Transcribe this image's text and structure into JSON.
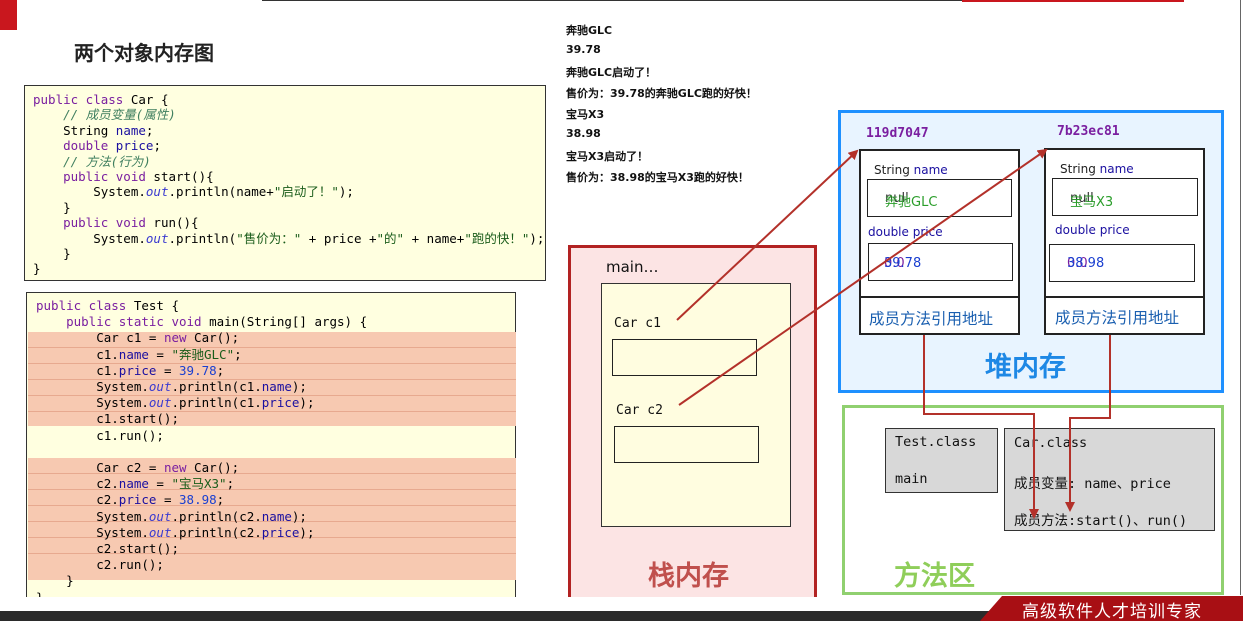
{
  "title": "两个对象内存图",
  "car_class_code": [
    {
      "parts": [
        [
          "kw",
          "public class "
        ],
        [
          "",
          "Car {"
        ]
      ]
    },
    {
      "parts": [
        [
          "cm",
          "    // 成员变量(属性)"
        ]
      ]
    },
    {
      "parts": [
        [
          "",
          "    String "
        ],
        [
          "var",
          "name"
        ],
        [
          "",
          ";"
        ]
      ]
    },
    {
      "parts": [
        [
          "kw",
          "    double "
        ],
        [
          "var",
          "price"
        ],
        [
          "",
          ";"
        ]
      ]
    },
    {
      "parts": [
        [
          "cm",
          "    // 方法(行为)"
        ]
      ]
    },
    {
      "parts": [
        [
          "kw",
          "    public void "
        ],
        [
          "",
          "start(){"
        ]
      ]
    },
    {
      "parts": [
        [
          "",
          "        System."
        ],
        [
          "it",
          "out"
        ],
        [
          "",
          ".println(name+"
        ],
        [
          "str",
          "\"启动了！\""
        ],
        [
          "",
          ");"
        ]
      ]
    },
    {
      "parts": [
        [
          "",
          "    }"
        ]
      ]
    },
    {
      "parts": [
        [
          "kw",
          "    public void "
        ],
        [
          "",
          "run(){"
        ]
      ]
    },
    {
      "parts": [
        [
          "",
          "        System."
        ],
        [
          "it",
          "out"
        ],
        [
          "",
          ".println("
        ],
        [
          "str",
          "\"售价为：\""
        ],
        [
          "",
          " + price +"
        ],
        [
          "str",
          "\"的\""
        ],
        [
          "",
          " + name+"
        ],
        [
          "str",
          "\"跑的快！\""
        ],
        [
          "",
          ");"
        ]
      ]
    },
    {
      "parts": [
        [
          "",
          "    }"
        ]
      ]
    },
    {
      "parts": [
        [
          "",
          "}"
        ]
      ]
    }
  ],
  "test_class_code": [
    {
      "parts": [
        [
          "kw",
          "public class "
        ],
        [
          "",
          "Test {"
        ]
      ]
    },
    {
      "parts": [
        [
          "kw",
          "    public static void "
        ],
        [
          "",
          "main(String[] args) {"
        ]
      ]
    },
    {
      "parts": [
        [
          "",
          "        Car c1 = "
        ],
        [
          "kw",
          "new "
        ],
        [
          "",
          "Car();"
        ]
      ]
    },
    {
      "parts": [
        [
          "",
          "        c1."
        ],
        [
          "var",
          "name"
        ],
        [
          "",
          " = "
        ],
        [
          "str",
          "\"奔驰GLC\""
        ],
        [
          "",
          ";"
        ]
      ]
    },
    {
      "parts": [
        [
          "",
          "        c1."
        ],
        [
          "var",
          "price"
        ],
        [
          "",
          " = "
        ],
        [
          "num",
          "39.78"
        ],
        [
          "",
          ";"
        ]
      ]
    },
    {
      "parts": [
        [
          "",
          "        System."
        ],
        [
          "it",
          "out"
        ],
        [
          "",
          ".println(c1."
        ],
        [
          "var",
          "name"
        ],
        [
          "",
          ");"
        ]
      ]
    },
    {
      "parts": [
        [
          "",
          "        System."
        ],
        [
          "it",
          "out"
        ],
        [
          "",
          ".println(c1."
        ],
        [
          "var",
          "price"
        ],
        [
          "",
          ");"
        ]
      ]
    },
    {
      "parts": [
        [
          "",
          "        c1.start();"
        ]
      ]
    },
    {
      "parts": [
        [
          "",
          "        c1.run();"
        ]
      ]
    },
    {
      "parts": [
        [
          "",
          ""
        ]
      ]
    },
    {
      "parts": [
        [
          "",
          "        Car c2 = "
        ],
        [
          "kw",
          "new "
        ],
        [
          "",
          "Car();"
        ]
      ]
    },
    {
      "parts": [
        [
          "",
          "        c2."
        ],
        [
          "var",
          "name"
        ],
        [
          "",
          " = "
        ],
        [
          "str",
          "\"宝马X3\""
        ],
        [
          "",
          ";"
        ]
      ]
    },
    {
      "parts": [
        [
          "",
          "        c2."
        ],
        [
          "var",
          "price"
        ],
        [
          "",
          " = "
        ],
        [
          "num",
          "38.98"
        ],
        [
          "",
          ";"
        ]
      ]
    },
    {
      "parts": [
        [
          "",
          "        System."
        ],
        [
          "it",
          "out"
        ],
        [
          "",
          ".println(c2."
        ],
        [
          "var",
          "name"
        ],
        [
          "",
          ");"
        ]
      ]
    },
    {
      "parts": [
        [
          "",
          "        System."
        ],
        [
          "it",
          "out"
        ],
        [
          "",
          ".println(c2."
        ],
        [
          "var",
          "price"
        ],
        [
          "",
          ");"
        ]
      ]
    },
    {
      "parts": [
        [
          "",
          "        c2.start();"
        ]
      ]
    },
    {
      "parts": [
        [
          "",
          "        c2.run();"
        ]
      ]
    },
    {
      "parts": [
        [
          "",
          "    }"
        ]
      ]
    },
    {
      "parts": [
        [
          "",
          "}"
        ]
      ]
    }
  ],
  "console_output": [
    "奔驰GLC",
    "39.78",
    "奔驰GLC启动了！",
    "售价为：39.78的奔驰GLC跑的好快！",
    "宝马X3",
    "38.98",
    "宝马X3启动了！",
    "售价为：38.98的宝马X3跑的好快！"
  ],
  "stack": {
    "label": "栈内存",
    "frame_label": "main…",
    "var1": "Car  c1",
    "var2": "Car  c2"
  },
  "heap": {
    "label": "堆内存",
    "obj1": {
      "address": "119d7047",
      "field1_label": "String name",
      "field1_old": "null",
      "field1_new": "奔驰GLC",
      "field2_label": "double price",
      "field2_old": "0.0",
      "field2_new": "39.78",
      "method_ref": "成员方法引用地址"
    },
    "obj2": {
      "address": "7b23ec81",
      "field1_label": "String name",
      "field1_old": "null",
      "field1_new": "宝马X3",
      "field2_label": "double price",
      "field2_old": "0.0",
      "field2_new": "38.98",
      "method_ref": "成员方法引用地址"
    }
  },
  "method_area": {
    "label": "方法区",
    "test_class": "Test.class",
    "test_main": "main",
    "car_class": "Car.class",
    "car_fields": "成员变量: name、price",
    "car_methods": "成员方法:start()、run()"
  },
  "footer": "高级软件人才培训专家",
  "colors": {
    "stack_border": "#b22222",
    "heap_border": "#1e90ff",
    "method_border": "#90d070",
    "arrow": "#b3312a",
    "highlight": "#f7c9b1"
  }
}
